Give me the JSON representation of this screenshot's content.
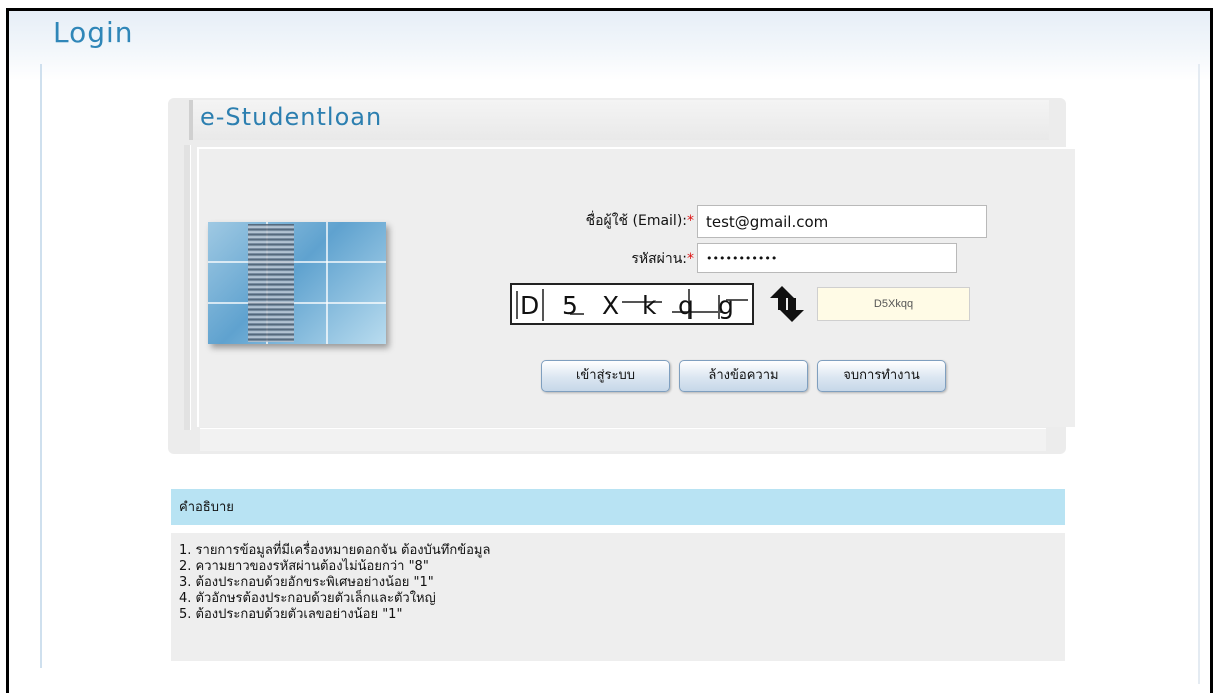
{
  "page": {
    "title": "Login"
  },
  "panel": {
    "title": "e-Studentloan"
  },
  "form": {
    "username": {
      "label": "ชื่อผู้ใช้ (Email):",
      "required_mark": "*",
      "value": "test@gmail.com"
    },
    "password": {
      "label": "รหัสผ่าน:",
      "required_mark": "*",
      "value": "•••••••••••"
    },
    "captcha": {
      "chars": [
        "D",
        "5",
        "X",
        "k",
        "q",
        "g"
      ],
      "input_value": "D5Xkqq",
      "refresh_icon": "refresh-arrows-icon"
    },
    "buttons": {
      "login": "เข้าสู่ระบบ",
      "clear": "ล้างข้อความ",
      "exit": "จบการทำงาน"
    }
  },
  "description": {
    "header": "คำอธิบาย",
    "items": [
      "1. รายการข้อมูลที่มีเครื่องหมายดอกจัน ต้องบันทึกข้อมูล",
      "2. ความยาวของรหัสผ่านต้องไม่น้อยกว่า \"8\"",
      "3. ต้องประกอบด้วยอักขระพิเศษอย่างน้อย \"1\"",
      "4. ตัวอักษรต้องประกอบด้วยตัวเล็กและตัวใหญ่",
      "5. ต้องประกอบด้วยตัวเลขอย่างน้อย \"1\""
    ]
  },
  "colors": {
    "title_blue": "#2f86b8",
    "desc_header_bg": "#b8e3f3",
    "required_red": "#dd1111"
  }
}
